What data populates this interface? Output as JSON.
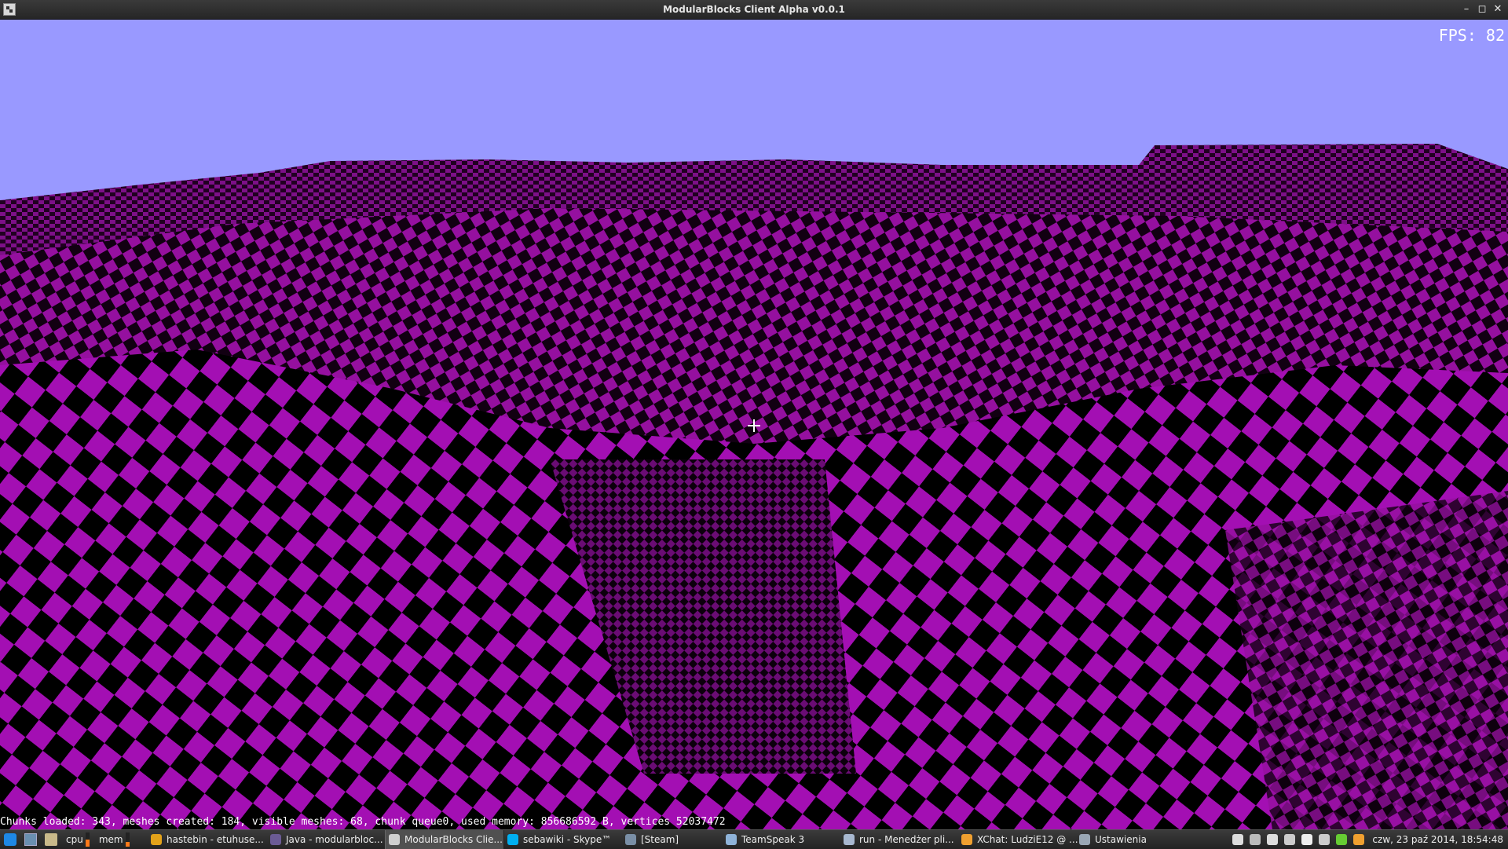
{
  "window": {
    "title": "ModularBlocks Client Alpha v0.0.1",
    "controls": {
      "minimize": "–",
      "maximize": "◻",
      "close": "✕"
    }
  },
  "game": {
    "fps_label": "FPS: 82",
    "debug_line": "Chunks loaded: 343, meshes created: 184, visible meshes: 68, chunk queue0, used memory: 856686592 B, vertices 52037472",
    "sky_color": "#9999ff",
    "block_colors": [
      "#a30fb3",
      "#000000"
    ]
  },
  "taskbar": {
    "quick_launch": [
      "start-menu-icon",
      "show-desktop-icon",
      "file-manager-icon"
    ],
    "monitors": [
      {
        "label": "cpu",
        "usage": 0.5
      },
      {
        "label": "mem",
        "usage": 0.35
      }
    ],
    "tasks": [
      {
        "label": "hastebin - etuhuse...",
        "icon": "chrome-icon",
        "color": "#e3a21a"
      },
      {
        "label": "Java - modularbloc...",
        "icon": "eclipse-icon",
        "color": "#6b5b95"
      },
      {
        "label": "ModularBlocks Clie...",
        "icon": "modularblocks-icon",
        "color": "#cfcfcf",
        "active": true
      },
      {
        "label": "sebawiki - Skype™",
        "icon": "skype-icon",
        "color": "#00aff0"
      },
      {
        "label": "[Steam]",
        "icon": "steam-icon",
        "color": "#7a8fa6"
      },
      {
        "label": "TeamSpeak 3",
        "icon": "teamspeak-icon",
        "color": "#8fb3d9"
      },
      {
        "label": "run - Menedżer pli...",
        "icon": "folder-icon",
        "color": "#a8b8d0"
      },
      {
        "label": "XChat: LudziE12 @ ...",
        "icon": "xchat-icon",
        "color": "#f0a030"
      },
      {
        "label": "Ustawienia",
        "icon": "settings-icon",
        "color": "#9aa7b5"
      }
    ],
    "tray_icons": [
      "network-icon",
      "steam-tray-icon",
      "volume-icon",
      "mail-icon",
      "dropbox-icon",
      "cloud-icon",
      "skype-tray-icon",
      "xchat-tray-icon"
    ],
    "clock": "czw, 23 paź 2014, 18:54:48"
  }
}
